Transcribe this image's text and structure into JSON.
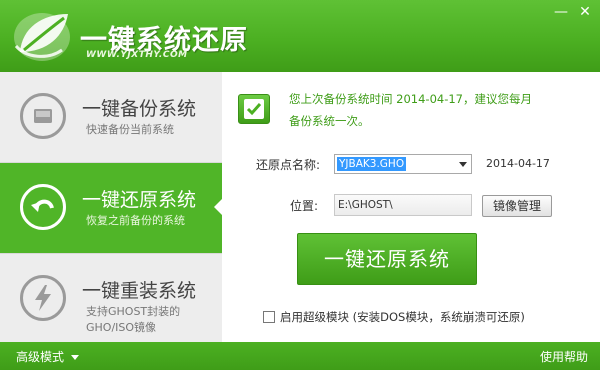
{
  "header": {
    "title": "一键系统还原",
    "url": "WWW.YJXTHY.COM",
    "minimize_glyph": "—",
    "close_glyph": "✕"
  },
  "sidebar": {
    "items": [
      {
        "title": "一键备份系统",
        "subtitle_line1": "快速备份当前系统",
        "subtitle_line2": "",
        "icon": "disk-icon",
        "active": false
      },
      {
        "title": "一键还原系统",
        "subtitle_line1": "恢复之前备份的系统",
        "subtitle_line2": "",
        "icon": "undo-arrow-icon",
        "active": true
      },
      {
        "title": "一键重装系统",
        "subtitle_line1": "支持GHOST封装的",
        "subtitle_line2": "GHO/ISO镜像",
        "icon": "lightning-icon",
        "active": false
      }
    ]
  },
  "main": {
    "notice_line1": "您上次备份系统时间 2014-04-17，建议您每月",
    "notice_line2": "备份系统一次。",
    "restore_point_label": "还原点名称:",
    "restore_point_value": "YJBAK3.GHO",
    "restore_point_date": "2014-04-17",
    "location_label": "位置:",
    "location_value": "E:\\GHOST\\",
    "manage_button": "镜像管理",
    "restore_button": "一键还原系统",
    "super_module_label": "启用超级模块 (安装DOS模块，系统崩溃可还原)",
    "super_module_checked": false
  },
  "footer": {
    "advanced_mode": "高级模式",
    "help": "使用帮助"
  },
  "colors": {
    "brand_green": "#4cb022",
    "dark_green": "#3f9d18",
    "selection_blue": "#3399ff"
  }
}
